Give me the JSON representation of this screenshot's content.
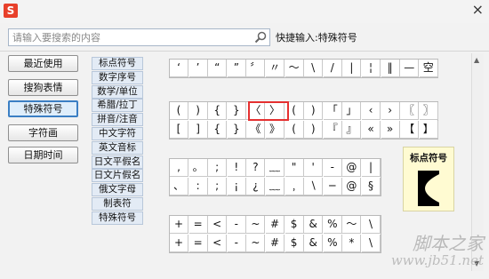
{
  "app": {
    "logo_letter": "S",
    "close_label": "×"
  },
  "search": {
    "placeholder": "请输入要搜索的内容",
    "value": ""
  },
  "quick_input": {
    "label": "快捷输入:",
    "value": "特殊符号"
  },
  "left_buttons": [
    {
      "label": "最近使用",
      "active": false
    },
    {
      "label": "搜狗表情",
      "active": false
    },
    {
      "label": "特殊符号",
      "active": true
    },
    {
      "label": "字符画",
      "active": false
    },
    {
      "label": "日期时间",
      "active": false
    }
  ],
  "categories": [
    "标点符号",
    "数字序号",
    "数学/单位",
    "希腊/拉丁",
    "拼音/注音",
    "中文字符",
    "英文音标",
    "日文平假名",
    "日文片假名",
    "俄文字母",
    "制表符",
    "特殊符号"
  ],
  "grids": [
    {
      "rows": [
        [
          "‘",
          "’",
          "“",
          "”",
          "〞",
          "〃",
          "〜",
          "\\",
          "/",
          "|",
          "¦",
          "‖",
          "—",
          "空"
        ]
      ]
    },
    {
      "rows": [
        [
          "(",
          ")",
          "{",
          "}",
          "〈",
          "〉",
          "(",
          ")",
          "「",
          "」",
          "‹",
          "›",
          "〖",
          "〗"
        ],
        [
          "[",
          "]",
          "{",
          "}",
          "《",
          "》",
          "(",
          ")",
          "『",
          "』",
          "«",
          "»",
          "【",
          "】"
        ]
      ]
    },
    {
      "rows": [
        [
          ",",
          "。",
          ";",
          "!",
          "?",
          "﹏",
          "\"",
          "'",
          "‐",
          "@",
          "|"
        ],
        [
          "、",
          ":",
          ";",
          "¡",
          "¿",
          "﹏",
          "﹐",
          "∖",
          "─",
          "@",
          "§"
        ]
      ]
    },
    {
      "rows": [
        [
          "+",
          "=",
          "<",
          "-",
          "~",
          "#",
          "$",
          "&",
          "%",
          "〜",
          "\\"
        ],
        [
          "+",
          "=",
          "<",
          "-",
          "~",
          "#",
          "$",
          "&",
          "%",
          "*",
          "\\"
        ]
      ]
    }
  ],
  "preview": {
    "title": "标点符号",
    "glyph": "【"
  },
  "watermark": {
    "line1": "脚本之家",
    "line2": "www.jb51.net"
  }
}
